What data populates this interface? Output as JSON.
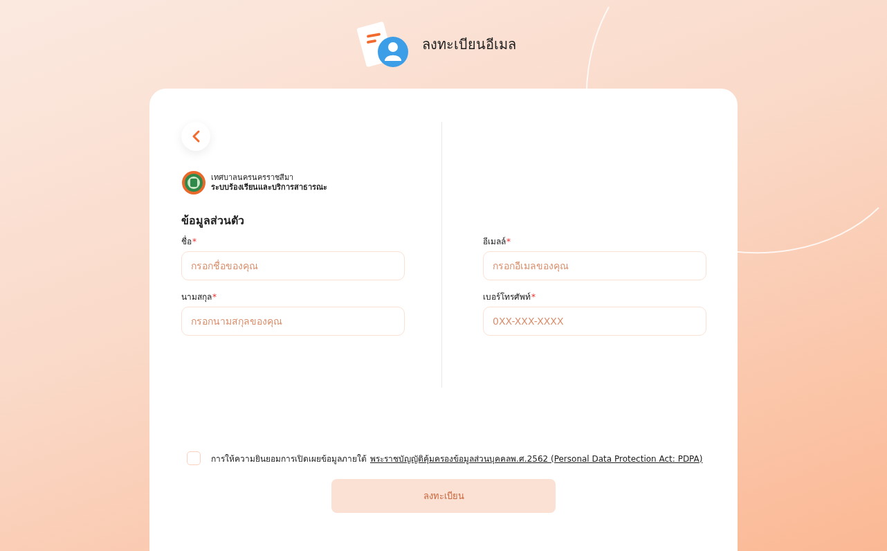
{
  "header": {
    "title": "ลงทะเบียนอีเมล"
  },
  "organization": {
    "name": "เทศบาลนครนครราชสีมา",
    "system": "ระบบร้องเรียนและบริการสาธารณะ"
  },
  "section_title": "ข้อมูลส่วนตัว",
  "columns": [
    {
      "fields": [
        {
          "label": "ชื่อ",
          "required_mark": "*",
          "placeholder": "กรอกชื่อของคุณ"
        },
        {
          "label": "นามสกุล",
          "required_mark": "*",
          "placeholder": "กรอกนามสกุลของคุณ"
        }
      ]
    },
    {
      "fields": [
        {
          "label": "อีเมลล์",
          "required_mark": "*",
          "placeholder": "กรอกอีเมลของคุณ"
        },
        {
          "label": "เบอร์โทรศัพท์",
          "required_mark": "*",
          "placeholder": "0XX-XXX-XXXX"
        }
      ]
    }
  ],
  "consent": {
    "checked": false,
    "text": "การให้ความยินยอมการเปิดเผยข้อมูลภายใต้",
    "link": "พระราชบัญญัติคุ้มครองข้อมูลส่วนบุคคลพ.ศ.2562 (Personal Data Protection Act: PDPA)"
  },
  "submit": {
    "label": "ลงทะเบียน",
    "disabled": true
  }
}
